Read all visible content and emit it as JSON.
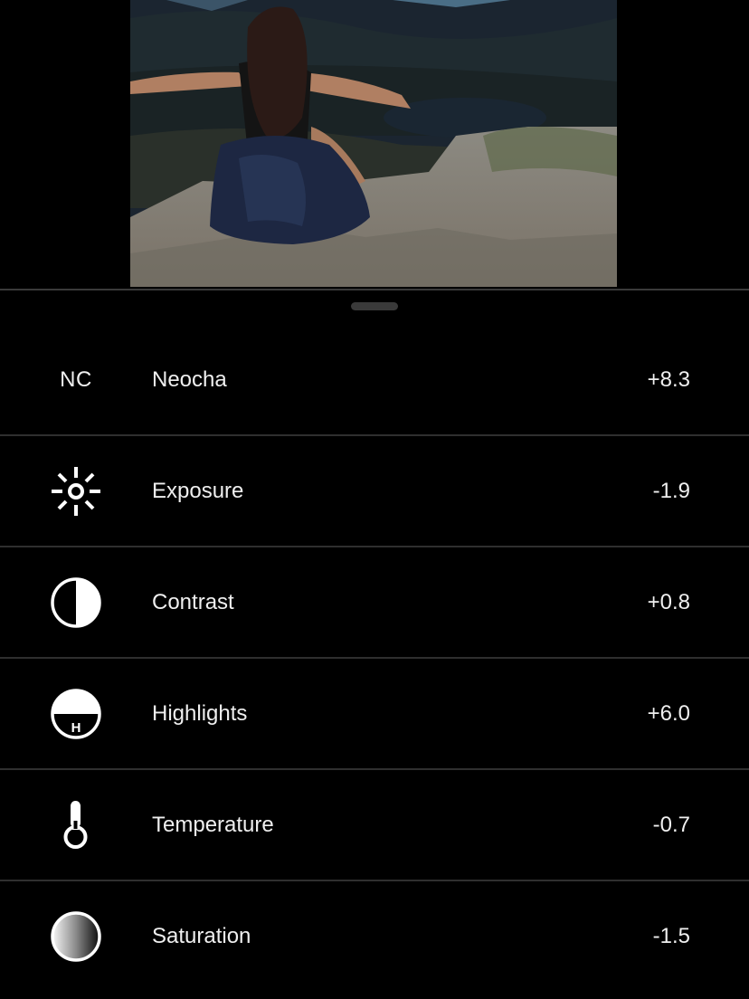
{
  "photo": {
    "description": "Woman sitting on rocky cliff with arms outstretched overlooking mountain lake"
  },
  "adjustments": [
    {
      "icon": "neocha-filter-icon",
      "icon_text": "NC",
      "label": "Neocha",
      "value": "+8.3"
    },
    {
      "icon": "exposure-sun-icon",
      "label": "Exposure",
      "value": "-1.9"
    },
    {
      "icon": "contrast-icon",
      "label": "Contrast",
      "value": "+0.8"
    },
    {
      "icon": "highlights-icon",
      "icon_text": "H",
      "label": "Highlights",
      "value": "+6.0"
    },
    {
      "icon": "temperature-thermometer-icon",
      "label": "Temperature",
      "value": "-0.7"
    },
    {
      "icon": "saturation-icon",
      "label": "Saturation",
      "value": "-1.5"
    }
  ]
}
